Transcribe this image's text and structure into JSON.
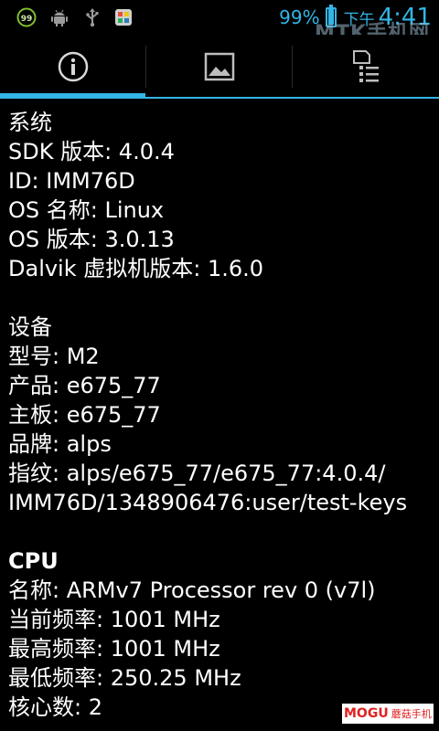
{
  "status_bar": {
    "icons": [
      "badge-99-icon",
      "android-icon",
      "usb-icon",
      "app-notification-icon"
    ],
    "badge_text": "99",
    "battery_percent": "99%",
    "battery_level": 0.99,
    "ampm": "下午",
    "time": "4:41",
    "accent_color": "#33b5e5"
  },
  "watermark_top": {
    "big": "MTK手机网",
    "small": "WWW.MTKSJ.COM"
  },
  "tabs": [
    {
      "icon": "info-icon",
      "selected": true
    },
    {
      "icon": "image-icon",
      "selected": false
    },
    {
      "icon": "list-icon",
      "selected": false
    }
  ],
  "system": {
    "title": "系统",
    "sdk": "SDK 版本: 4.0.4",
    "id": "ID: IMM76D",
    "os_name": "OS 名称: Linux",
    "os_version": "OS 版本: 3.0.13",
    "dalvik": "Dalvik 虚拟机版本: 1.6.0"
  },
  "device": {
    "title": "设备",
    "model": "型号: M2",
    "product": "产品: e675_77",
    "board": "主板: e675_77",
    "brand": "品牌: alps",
    "fingerprint_line1": "指纹: alps/e675_77/e675_77:4.0.4/",
    "fingerprint_line2": "IMM76D/1348906476:user/test-keys"
  },
  "cpu": {
    "title": "CPU",
    "name": "名称: ARMv7 Processor rev 0 (v7l)",
    "current_freq": "当前频率: 1001 MHz",
    "max_freq": "最高频率: 1001 MHz",
    "min_freq": "最低频率: 250.25 MHz",
    "cores": "核心数: 2"
  },
  "watermark_bottom": {
    "brand": "MOGU",
    "cn": "蘑菇手机"
  }
}
